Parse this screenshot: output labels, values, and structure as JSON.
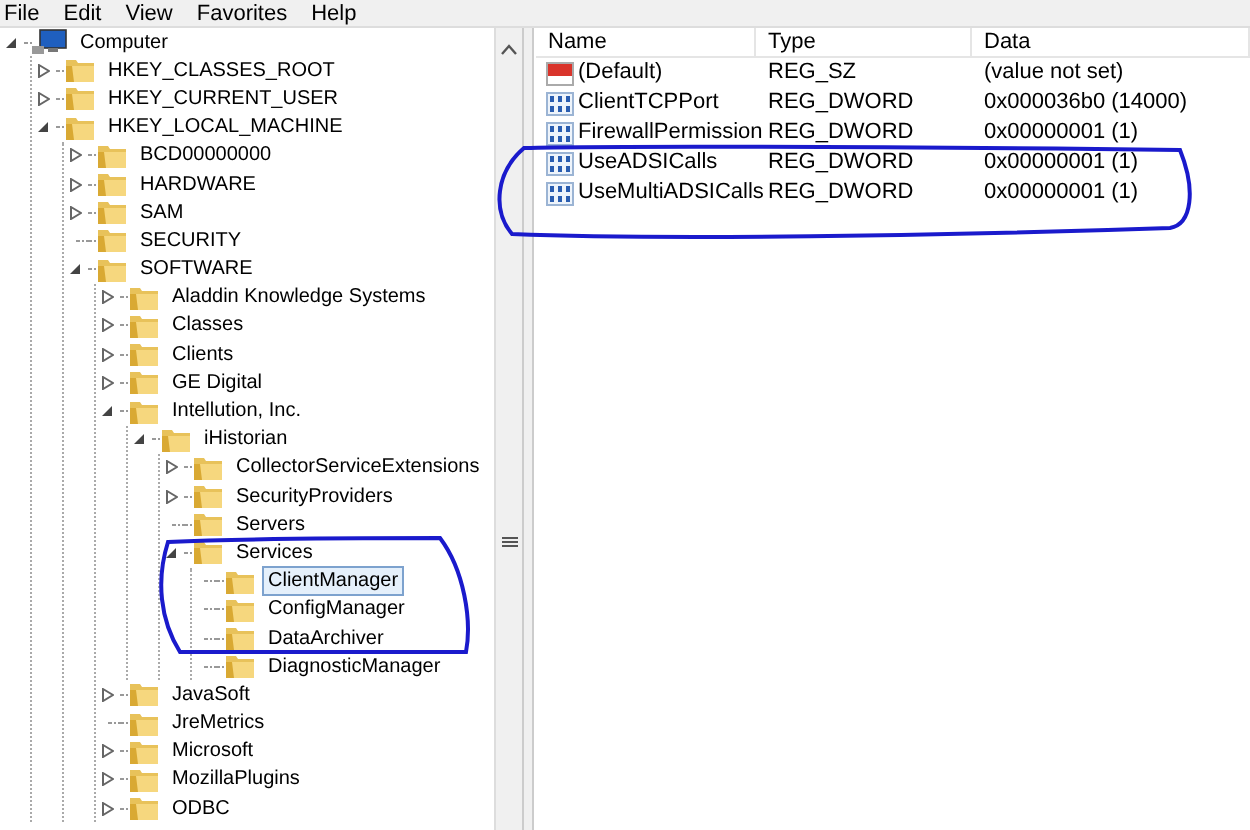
{
  "menu": [
    "File",
    "Edit",
    "View",
    "Favorites",
    "Help"
  ],
  "tree": [
    {
      "label": "Computer",
      "kind": "computer",
      "expanded": true,
      "selected": false,
      "children": [
        {
          "label": "HKEY_CLASSES_ROOT",
          "kind": "expandable",
          "expanded": false,
          "selected": false
        },
        {
          "label": "HKEY_CURRENT_USER",
          "kind": "expandable",
          "expanded": false,
          "selected": false
        },
        {
          "label": "HKEY_LOCAL_MACHINE",
          "kind": "expandable",
          "expanded": true,
          "selected": false,
          "children": [
            {
              "label": "BCD00000000",
              "kind": "expandable",
              "expanded": false,
              "selected": false
            },
            {
              "label": "HARDWARE",
              "kind": "expandable",
              "expanded": false,
              "selected": false
            },
            {
              "label": "SAM",
              "kind": "expandable",
              "expanded": false,
              "selected": false
            },
            {
              "label": "SECURITY",
              "kind": "leaf",
              "selected": false
            },
            {
              "label": "SOFTWARE",
              "kind": "expandable",
              "expanded": true,
              "selected": false,
              "children": [
                {
                  "label": "Aladdin Knowledge Systems",
                  "kind": "expandable",
                  "expanded": false,
                  "selected": false
                },
                {
                  "label": "Classes",
                  "kind": "expandable",
                  "expanded": false,
                  "selected": false
                },
                {
                  "label": "Clients",
                  "kind": "expandable",
                  "expanded": false,
                  "selected": false
                },
                {
                  "label": "GE Digital",
                  "kind": "expandable",
                  "expanded": false,
                  "selected": false
                },
                {
                  "label": "Intellution, Inc.",
                  "kind": "expandable",
                  "expanded": true,
                  "selected": false,
                  "children": [
                    {
                      "label": "iHistorian",
                      "kind": "expandable",
                      "expanded": true,
                      "selected": false,
                      "children": [
                        {
                          "label": "CollectorServiceExtensions",
                          "kind": "expandable",
                          "expanded": false,
                          "selected": false
                        },
                        {
                          "label": "SecurityProviders",
                          "kind": "expandable",
                          "expanded": false,
                          "selected": false
                        },
                        {
                          "label": "Servers",
                          "kind": "leaf",
                          "selected": false
                        },
                        {
                          "label": "Services",
                          "kind": "expandable",
                          "expanded": true,
                          "selected": false,
                          "children": [
                            {
                              "label": "ClientManager",
                              "kind": "leaf",
                              "selected": true
                            },
                            {
                              "label": "ConfigManager",
                              "kind": "leaf",
                              "selected": false
                            },
                            {
                              "label": "DataArchiver",
                              "kind": "leaf",
                              "selected": false
                            },
                            {
                              "label": "DiagnosticManager",
                              "kind": "leaf",
                              "selected": false
                            }
                          ]
                        }
                      ]
                    }
                  ]
                },
                {
                  "label": "JavaSoft",
                  "kind": "expandable",
                  "expanded": false,
                  "selected": false
                },
                {
                  "label": "JreMetrics",
                  "kind": "leaf",
                  "selected": false
                },
                {
                  "label": "Microsoft",
                  "kind": "expandable",
                  "expanded": false,
                  "selected": false
                },
                {
                  "label": "MozillaPlugins",
                  "kind": "expandable",
                  "expanded": false,
                  "selected": false
                },
                {
                  "label": "ODBC",
                  "kind": "expandable",
                  "expanded": false,
                  "selected": false
                }
              ]
            }
          ]
        }
      ]
    }
  ],
  "values": {
    "columns": [
      "Name",
      "Type",
      "Data"
    ],
    "rows": [
      {
        "name": "(Default)",
        "kind": "string",
        "type": "REG_SZ",
        "data": "(value not set)"
      },
      {
        "name": "ClientTCPPort",
        "kind": "binary",
        "type": "REG_DWORD",
        "data": "0x000036b0 (14000)"
      },
      {
        "name": "FirewallPermission",
        "kind": "binary",
        "type": "REG_DWORD",
        "data": "0x00000001 (1)"
      },
      {
        "name": "UseADSICalls",
        "kind": "binary",
        "type": "REG_DWORD",
        "data": "0x00000001 (1)"
      },
      {
        "name": "UseMultiADSICalls",
        "kind": "binary",
        "type": "REG_DWORD",
        "data": "0x00000001 (1)"
      }
    ]
  }
}
